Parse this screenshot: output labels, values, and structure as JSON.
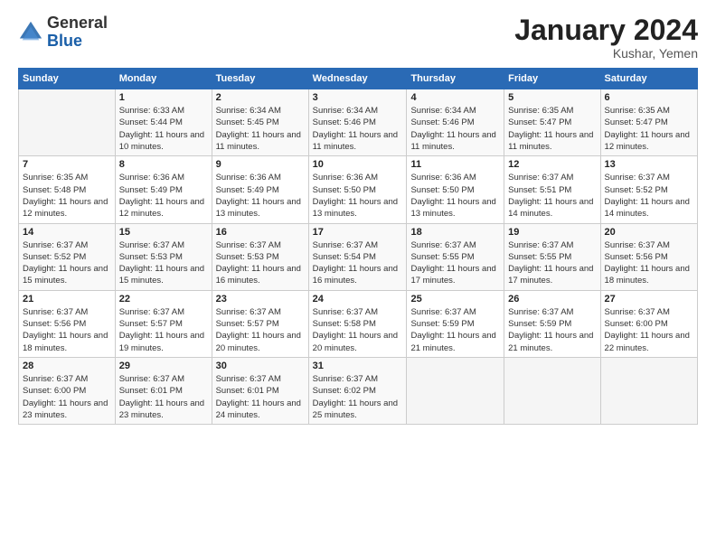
{
  "header": {
    "logo_general": "General",
    "logo_blue": "Blue",
    "month_title": "January 2024",
    "location": "Kushar, Yemen"
  },
  "days_of_week": [
    "Sunday",
    "Monday",
    "Tuesday",
    "Wednesday",
    "Thursday",
    "Friday",
    "Saturday"
  ],
  "weeks": [
    [
      {
        "day": "",
        "sunrise": "",
        "sunset": "",
        "daylight": ""
      },
      {
        "day": "1",
        "sunrise": "6:33 AM",
        "sunset": "5:44 PM",
        "daylight": "11 hours and 10 minutes."
      },
      {
        "day": "2",
        "sunrise": "6:34 AM",
        "sunset": "5:45 PM",
        "daylight": "11 hours and 11 minutes."
      },
      {
        "day": "3",
        "sunrise": "6:34 AM",
        "sunset": "5:46 PM",
        "daylight": "11 hours and 11 minutes."
      },
      {
        "day": "4",
        "sunrise": "6:34 AM",
        "sunset": "5:46 PM",
        "daylight": "11 hours and 11 minutes."
      },
      {
        "day": "5",
        "sunrise": "6:35 AM",
        "sunset": "5:47 PM",
        "daylight": "11 hours and 11 minutes."
      },
      {
        "day": "6",
        "sunrise": "6:35 AM",
        "sunset": "5:47 PM",
        "daylight": "11 hours and 12 minutes."
      }
    ],
    [
      {
        "day": "7",
        "sunrise": "6:35 AM",
        "sunset": "5:48 PM",
        "daylight": "11 hours and 12 minutes."
      },
      {
        "day": "8",
        "sunrise": "6:36 AM",
        "sunset": "5:49 PM",
        "daylight": "11 hours and 12 minutes."
      },
      {
        "day": "9",
        "sunrise": "6:36 AM",
        "sunset": "5:49 PM",
        "daylight": "11 hours and 13 minutes."
      },
      {
        "day": "10",
        "sunrise": "6:36 AM",
        "sunset": "5:50 PM",
        "daylight": "11 hours and 13 minutes."
      },
      {
        "day": "11",
        "sunrise": "6:36 AM",
        "sunset": "5:50 PM",
        "daylight": "11 hours and 13 minutes."
      },
      {
        "day": "12",
        "sunrise": "6:37 AM",
        "sunset": "5:51 PM",
        "daylight": "11 hours and 14 minutes."
      },
      {
        "day": "13",
        "sunrise": "6:37 AM",
        "sunset": "5:52 PM",
        "daylight": "11 hours and 14 minutes."
      }
    ],
    [
      {
        "day": "14",
        "sunrise": "6:37 AM",
        "sunset": "5:52 PM",
        "daylight": "11 hours and 15 minutes."
      },
      {
        "day": "15",
        "sunrise": "6:37 AM",
        "sunset": "5:53 PM",
        "daylight": "11 hours and 15 minutes."
      },
      {
        "day": "16",
        "sunrise": "6:37 AM",
        "sunset": "5:53 PM",
        "daylight": "11 hours and 16 minutes."
      },
      {
        "day": "17",
        "sunrise": "6:37 AM",
        "sunset": "5:54 PM",
        "daylight": "11 hours and 16 minutes."
      },
      {
        "day": "18",
        "sunrise": "6:37 AM",
        "sunset": "5:55 PM",
        "daylight": "11 hours and 17 minutes."
      },
      {
        "day": "19",
        "sunrise": "6:37 AM",
        "sunset": "5:55 PM",
        "daylight": "11 hours and 17 minutes."
      },
      {
        "day": "20",
        "sunrise": "6:37 AM",
        "sunset": "5:56 PM",
        "daylight": "11 hours and 18 minutes."
      }
    ],
    [
      {
        "day": "21",
        "sunrise": "6:37 AM",
        "sunset": "5:56 PM",
        "daylight": "11 hours and 18 minutes."
      },
      {
        "day": "22",
        "sunrise": "6:37 AM",
        "sunset": "5:57 PM",
        "daylight": "11 hours and 19 minutes."
      },
      {
        "day": "23",
        "sunrise": "6:37 AM",
        "sunset": "5:57 PM",
        "daylight": "11 hours and 20 minutes."
      },
      {
        "day": "24",
        "sunrise": "6:37 AM",
        "sunset": "5:58 PM",
        "daylight": "11 hours and 20 minutes."
      },
      {
        "day": "25",
        "sunrise": "6:37 AM",
        "sunset": "5:59 PM",
        "daylight": "11 hours and 21 minutes."
      },
      {
        "day": "26",
        "sunrise": "6:37 AM",
        "sunset": "5:59 PM",
        "daylight": "11 hours and 21 minutes."
      },
      {
        "day": "27",
        "sunrise": "6:37 AM",
        "sunset": "6:00 PM",
        "daylight": "11 hours and 22 minutes."
      }
    ],
    [
      {
        "day": "28",
        "sunrise": "6:37 AM",
        "sunset": "6:00 PM",
        "daylight": "11 hours and 23 minutes."
      },
      {
        "day": "29",
        "sunrise": "6:37 AM",
        "sunset": "6:01 PM",
        "daylight": "11 hours and 23 minutes."
      },
      {
        "day": "30",
        "sunrise": "6:37 AM",
        "sunset": "6:01 PM",
        "daylight": "11 hours and 24 minutes."
      },
      {
        "day": "31",
        "sunrise": "6:37 AM",
        "sunset": "6:02 PM",
        "daylight": "11 hours and 25 minutes."
      },
      {
        "day": "",
        "sunrise": "",
        "sunset": "",
        "daylight": ""
      },
      {
        "day": "",
        "sunrise": "",
        "sunset": "",
        "daylight": ""
      },
      {
        "day": "",
        "sunrise": "",
        "sunset": "",
        "daylight": ""
      }
    ]
  ],
  "labels": {
    "sunrise": "Sunrise:",
    "sunset": "Sunset:",
    "daylight": "Daylight:"
  }
}
